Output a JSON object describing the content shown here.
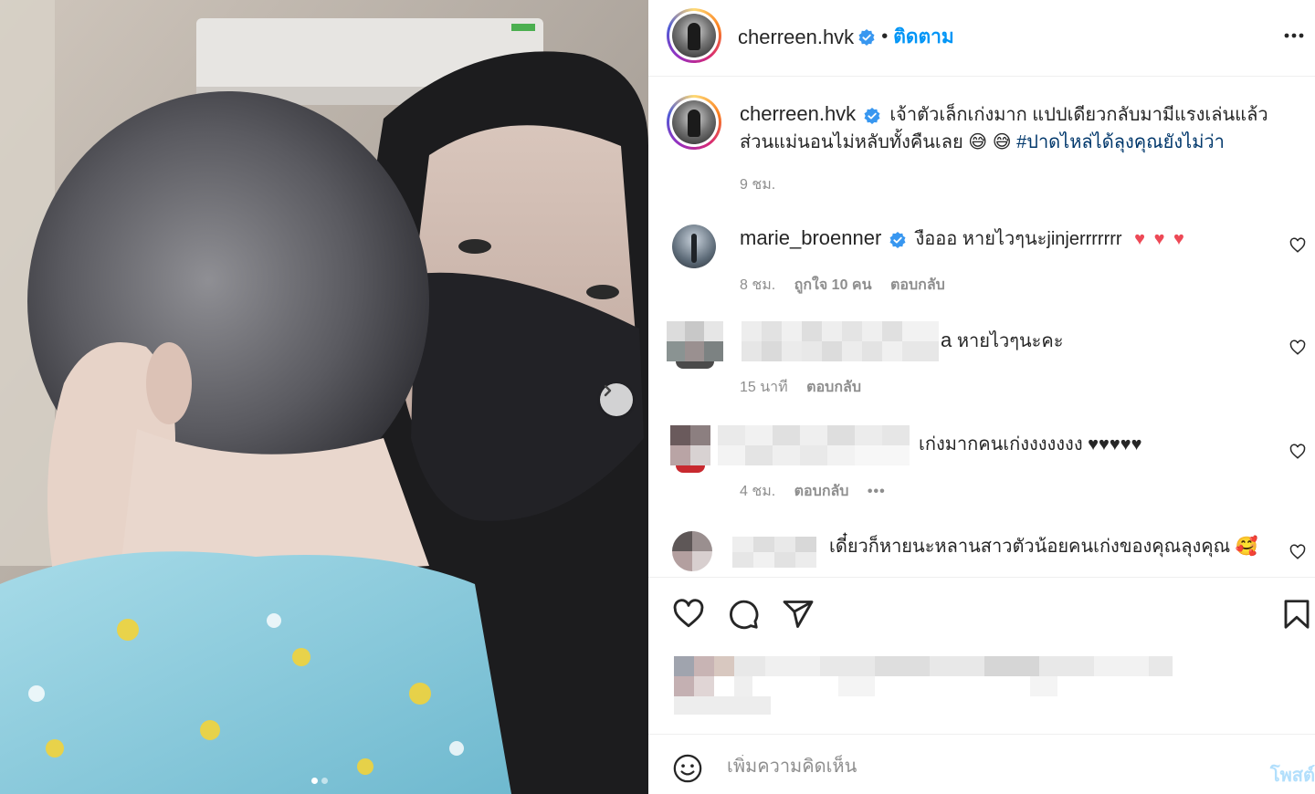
{
  "post": {
    "author": "cherreen.hvk",
    "follow_label": "ติดตาม",
    "sep": "•",
    "caption_line1": "เจ้าตัวเล็กเก่งมาก แปปเดียวกลับมามีแรงเล่นแล้ว",
    "caption_line2": "ส่วนแม่นอนไม่หลับทั้งคืนเลย",
    "caption_emoji": "😅 😅",
    "hashtag": "#ปาดไหล่ได้ลุงคุณยังไม่ว่า",
    "time": "9 ชม."
  },
  "comments": [
    {
      "username": "marie_broenner",
      "text": "งือออ หายไวๆนะjinjerrrrrrr",
      "hearts": "♥ ♥ ♥",
      "time": "8 ชม.",
      "likes": "ถูกใจ 10 คน",
      "reply": "ตอบกลับ"
    },
    {
      "name_tail": "a",
      "text": "หายไวๆนะคะ",
      "time": "15 นาที",
      "reply": "ตอบกลับ"
    },
    {
      "text": "เก่งมากคนเก่งงงงงงง ♥♥♥♥♥",
      "time": "4 ชม.",
      "reply": "ตอบกลับ",
      "more": "•••"
    },
    {
      "text": "เดี๋ยวก็หายนะหลานสาวตัวน้อยคนเก่งของคุณลุงคุณ 🥰"
    }
  ],
  "add_comment": {
    "placeholder": "เพิ่มความคิดเห็น",
    "post_label": "โพสต์"
  },
  "colors": {
    "link_blue": "#0095f6",
    "verified_blue": "#3897f0",
    "heart_red": "#ed4956",
    "hashtag": "#00376b",
    "muted": "#8e8e8e"
  },
  "icons": [
    "verified-badge-icon",
    "more-options-icon",
    "heart-icon",
    "comment-icon",
    "share-icon",
    "bookmark-icon",
    "emoji-icon",
    "chevron-right-icon"
  ]
}
